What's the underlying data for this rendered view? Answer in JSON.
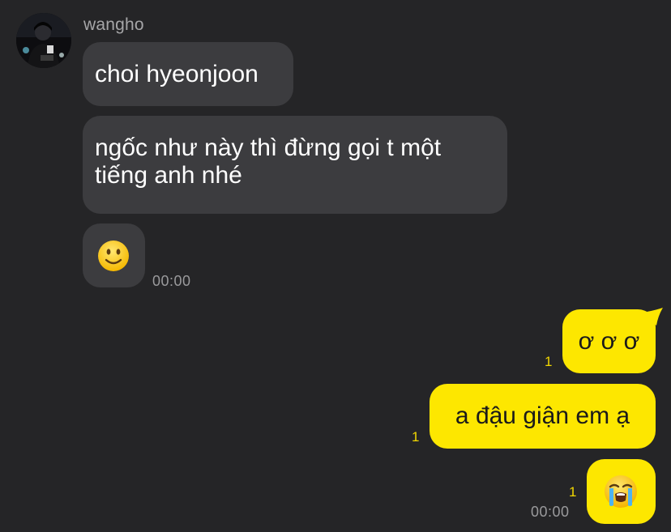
{
  "chat": {
    "sender_name": "wangho",
    "incoming": [
      {
        "text": "choi hyeonjoon"
      },
      {
        "text_line1": "ngốc như này thì đừng gọi t một",
        "text_line2": "tiếng anh nhé"
      },
      {
        "emoji": "slightly-smiling-face-emoji"
      }
    ],
    "incoming_time": "00:00",
    "outgoing": [
      {
        "text": "ơ ơ ơ",
        "unread": "1"
      },
      {
        "text": "a đậu giận em ạ",
        "unread": "1"
      },
      {
        "emoji": "loudly-crying-face-emoji",
        "unread": "1"
      }
    ],
    "outgoing_time": "00:00"
  },
  "colors": {
    "background": "#252527",
    "incoming_bubble": "#3c3c3f",
    "outgoing_bubble": "#fde700",
    "unread_count": "#f2d700",
    "timestamp": "#9a9a9c"
  }
}
